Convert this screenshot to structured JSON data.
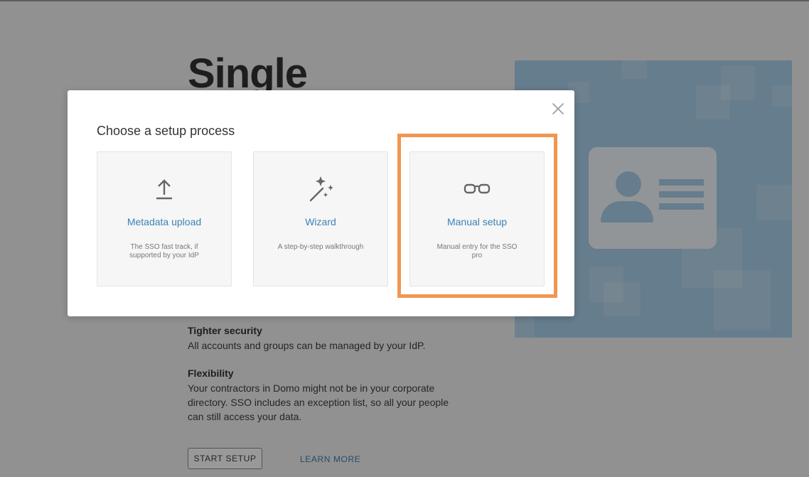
{
  "page": {
    "title": "Single",
    "features": [
      {
        "title": "Tighter security",
        "text": "All accounts and groups can be managed by your IdP."
      },
      {
        "title": "Flexibility",
        "text": "Your contractors in Domo might not be in your corporate directory. SSO includes an exception list, so all your people can still access your data."
      }
    ],
    "start_setup_label": "START SETUP",
    "learn_more_label": "LEARN MORE"
  },
  "modal": {
    "title": "Choose a setup process",
    "close_icon": "close-icon",
    "options": [
      {
        "label": "Metadata upload",
        "description": "The SSO fast track, if supported by your IdP",
        "icon": "upload-icon"
      },
      {
        "label": "Wizard",
        "description": "A step-by-step walkthrough",
        "icon": "magic-wand-icon"
      },
      {
        "label": "Manual setup",
        "description": "Manual entry for the SSO pro",
        "icon": "glasses-icon"
      }
    ],
    "highlighted_option": "Manual setup"
  },
  "colors": {
    "accent_link": "#3b82b5",
    "highlight": "#f29650",
    "hero_background": "#a9d0ec"
  }
}
